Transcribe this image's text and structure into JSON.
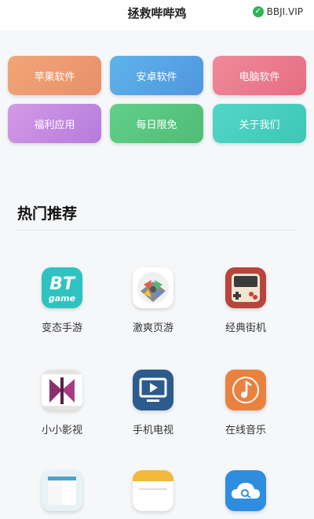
{
  "header": {
    "title": "拯救哔哔鸡",
    "badge": "BBJI.VIP"
  },
  "categories": [
    {
      "label": "苹果软件"
    },
    {
      "label": "安卓软件"
    },
    {
      "label": "电脑软件"
    },
    {
      "label": "福利应用"
    },
    {
      "label": "每日限免"
    },
    {
      "label": "关于我们"
    }
  ],
  "section": {
    "title": "热门推荐"
  },
  "apps": [
    {
      "label": "变态手游",
      "icon": "bt-game-icon",
      "icon_text": "BT",
      "icon_subtext": "game"
    },
    {
      "label": "激爽页游",
      "icon": "gamepad-icon"
    },
    {
      "label": "经典街机",
      "icon": "arcade-console-icon"
    },
    {
      "label": "小小影视",
      "icon": "film-butterfly-icon"
    },
    {
      "label": "手机电视",
      "icon": "tv-play-icon"
    },
    {
      "label": "在线音乐",
      "icon": "music-note-icon"
    },
    {
      "label": "",
      "icon": "book-icon"
    },
    {
      "label": "",
      "icon": "notes-icon"
    },
    {
      "label": "",
      "icon": "cloud-search-icon"
    }
  ],
  "colors": {
    "badge_check": "#2fb35a",
    "bt_icon": "#2ec3c0",
    "tv_icon": "#2c5c8d",
    "music_icon": "#e9823f",
    "cloud_icon": "#2f8de0"
  }
}
